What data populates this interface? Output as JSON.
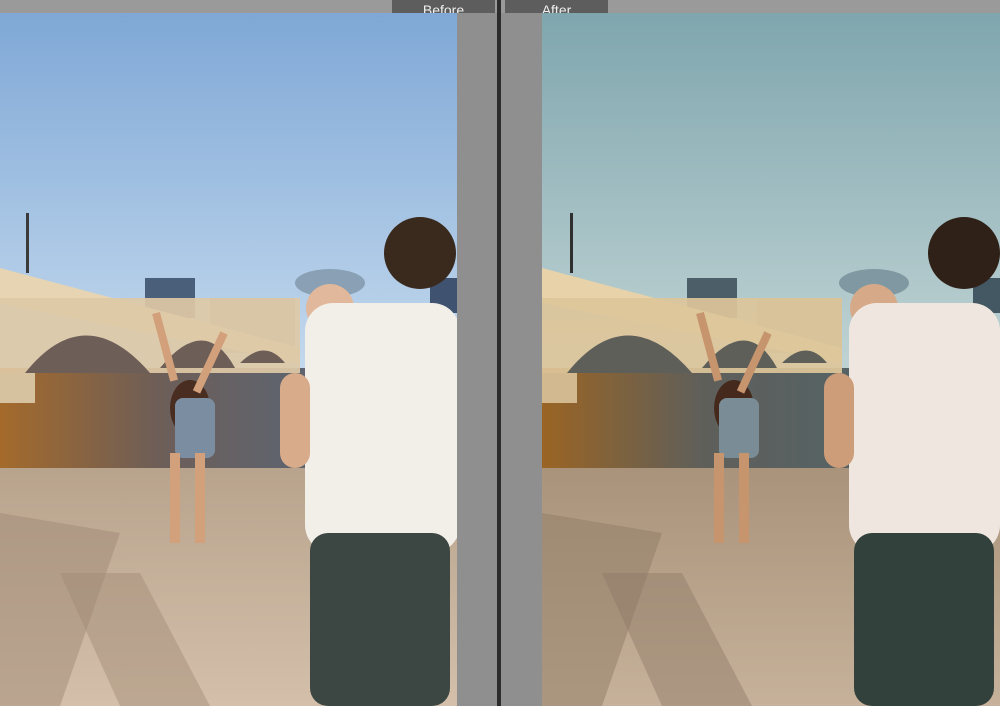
{
  "compare": {
    "before_label": "Before",
    "after_label": "After"
  },
  "photo": {
    "before": {
      "sky": "#a9c6e5",
      "sky_top": "#7fa8d6",
      "water": "#566c86",
      "sand": "#c7b29c"
    },
    "after": {
      "sky": "#a8c4c9",
      "sky_top": "#7fa6ae",
      "water": "#4f6670",
      "sand": "#b9a58e"
    }
  }
}
